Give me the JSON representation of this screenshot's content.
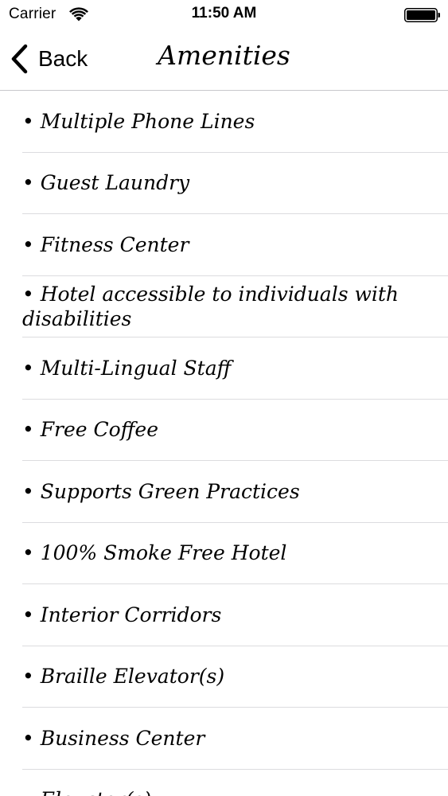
{
  "status_bar": {
    "carrier": "Carrier",
    "time": "11:50 AM",
    "icons": [
      "wifi-icon",
      "battery-icon"
    ]
  },
  "nav_bar": {
    "back_label": "Back",
    "back_icon": "chevron-left-icon",
    "title": "Amenities"
  },
  "amenities": [
    "• Multiple Phone Lines",
    "• Guest Laundry",
    "• Fitness Center",
    "• Hotel accessible to individuals with disabilities",
    "• Multi-Lingual Staff",
    "• Free Coffee",
    "• Supports Green Practices",
    "• 100% Smoke Free Hotel",
    "• Interior Corridors",
    "• Braille Elevator(s)",
    "• Business Center",
    "• Elevator(s)"
  ],
  "colors": {
    "text": "#000000",
    "separator": "#dcdcdf",
    "background": "#ffffff"
  }
}
